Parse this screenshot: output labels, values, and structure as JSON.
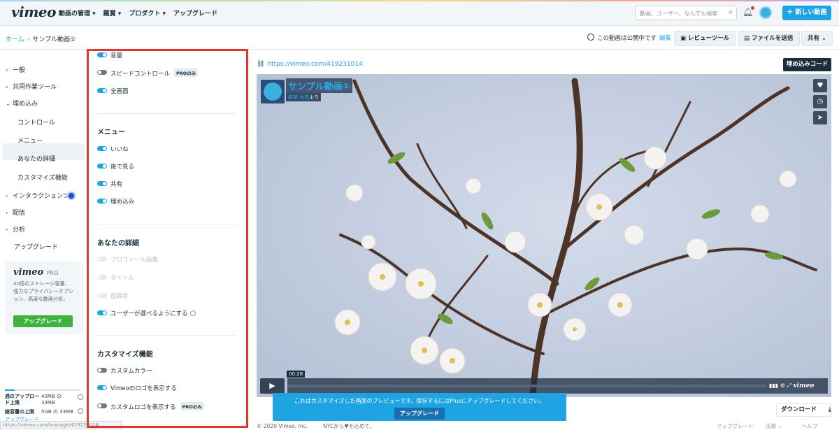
{
  "topbar": {
    "logo": "vimeo",
    "nav": [
      "動画の管理 ▾",
      "鑑賞 ▾",
      "プロダクト ▾",
      "アップグレード"
    ],
    "search_placeholder": "動画、ユーザー、なんでも検索",
    "new_video": "＋ 新しい動画"
  },
  "subbar": {
    "home": "ホーム",
    "sep": "›",
    "video_name": "サンプル動画①",
    "public_status": "この動画は公開中です",
    "edit": "編集",
    "review_tool": "レビューツール",
    "send_file": "ファイルを送信",
    "share": "共有 ⌄"
  },
  "sidebar": {
    "items": [
      {
        "label": "一般",
        "chev": "›"
      },
      {
        "label": "共同作業ツール",
        "chev": "›"
      },
      {
        "label": "埋め込み",
        "chev": "⌄"
      },
      {
        "label": "インタラクションツール",
        "chev": "›"
      },
      {
        "label": "配信",
        "chev": "›"
      },
      {
        "label": "分析",
        "chev": "›"
      }
    ],
    "subitems": [
      "コントロール",
      "メニュー",
      "あなたの詳細",
      "カスタマイズ機能"
    ],
    "upgrade_link": "アップグレード",
    "pro": {
      "brand": "vimeo",
      "tier": "PRO",
      "desc": "40倍のストレージ容量、強力なプライバシーオプション、高度な動画分析。",
      "button": "アップグレード"
    },
    "quota": {
      "weekly_label": "週のアップロード上限",
      "weekly_value": "40MB の 33MB",
      "total_label": "総容量の上限",
      "total_value": "5GB の 33MB",
      "upgrade": "アップグレード"
    },
    "status_url": "https://vimeo.com/manage/419231014"
  },
  "settings": {
    "top_toggles": [
      {
        "label": "音量",
        "state": "on"
      },
      {
        "label": "スピードコントロール",
        "state": "off",
        "badge": "PROのみ"
      },
      {
        "label": "全画面",
        "state": "on"
      }
    ],
    "menu_title": "メニュー",
    "menu_toggles": [
      {
        "label": "いいね",
        "state": "on"
      },
      {
        "label": "後で見る",
        "state": "on"
      },
      {
        "label": "共有",
        "state": "on"
      },
      {
        "label": "埋め込み",
        "state": "on"
      }
    ],
    "details_title": "あなたの詳細",
    "details_toggles": [
      {
        "label": "プロフィール画像",
        "state": "disabled"
      },
      {
        "label": "タイトル",
        "state": "disabled"
      },
      {
        "label": "投稿者",
        "state": "disabled"
      },
      {
        "label": "ユーザーが選べるようにする",
        "state": "on"
      }
    ],
    "custom_title": "カスタマイズ機能",
    "custom_toggles": [
      {
        "label": "カスタムカラー",
        "state": "off"
      },
      {
        "label": "Vimeoのロゴを表示する",
        "state": "on"
      },
      {
        "label": "カスタムロゴを表示する",
        "state": "off",
        "badge": "PROのみ"
      }
    ]
  },
  "preview": {
    "url": "https://vimeo.com/419231014",
    "embed_code": "埋め込みコード",
    "video_title": "サンプル動画①",
    "byline_user": "鷹架 太郎",
    "byline_suffix": "より",
    "time": "00:28",
    "player_logo": "vimeo",
    "toast_text": "これはカスタマイズした画面のプレビューです。保存するにはPlusにアップグレードしてください。",
    "toast_button": "アップグレード",
    "download": "ダウンロード"
  },
  "footer": {
    "copyright": "© 2020 Vimeo, Inc.",
    "made_with": "NYCから♥を込めて。",
    "links": [
      "アップグレード",
      "法務 ⌄",
      "ヘルプ"
    ]
  },
  "colors": {
    "accent": "#1fa4e3",
    "highlight_border": "#e0392b",
    "upgrade_green": "#3db33d"
  }
}
